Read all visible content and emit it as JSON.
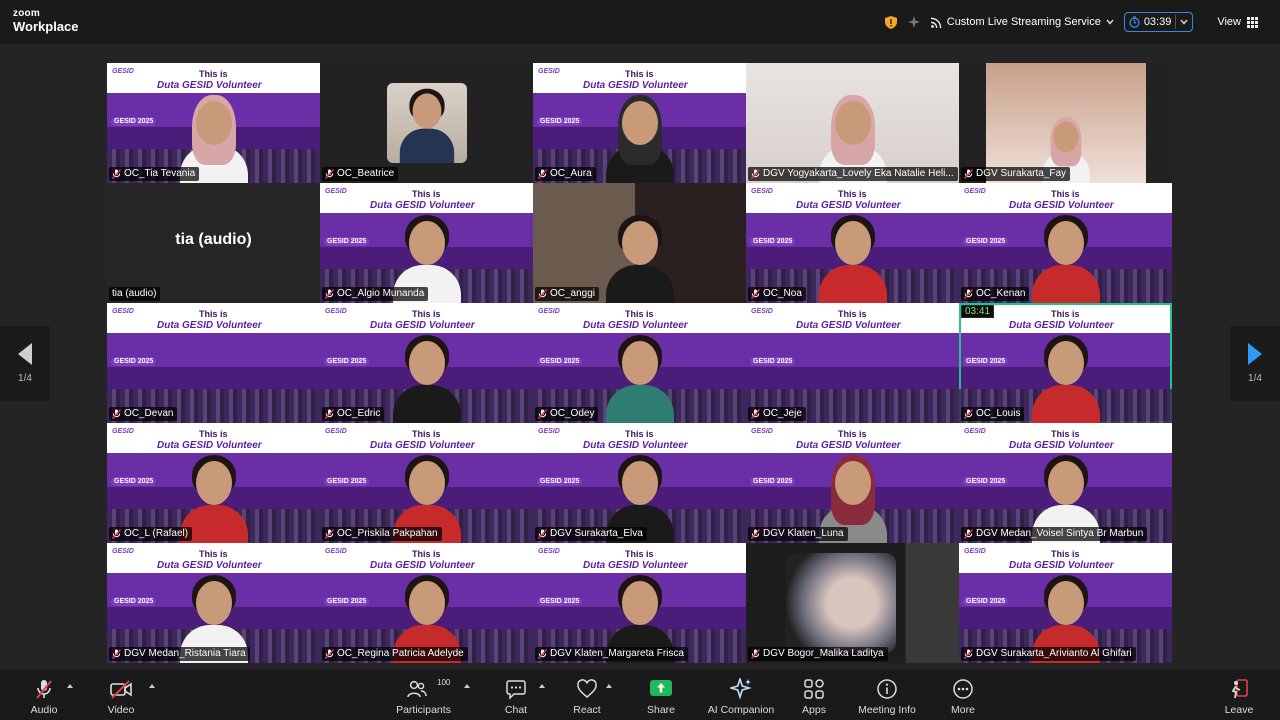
{
  "app": {
    "logo_line1": "zoom",
    "logo_line2": "Workplace"
  },
  "topbar": {
    "streaming_label": "Custom Live Streaming Service",
    "timer": "03:39",
    "view_label": "View"
  },
  "banner": {
    "line1": "This is",
    "line2": "Duta GESID Volunteer",
    "tag": "GESID 2025",
    "corner": "GESID"
  },
  "tiles": [
    {
      "name": "OC_Tia Tevania",
      "bg": "banner",
      "person": "hijab pink shirt-white"
    },
    {
      "name": "OC_Beatrice",
      "bg": "dark-photo",
      "person": ""
    },
    {
      "name": "OC_Aura",
      "bg": "banner",
      "person": "hijab dark shirt-black"
    },
    {
      "name": "DGV Yogyakarta_Lovely Eka Natalie Heli...",
      "bg": "room",
      "person": "hijab pink shirt-white"
    },
    {
      "name": "DGV Surakarta_Fay",
      "bg": "pip",
      "person": ""
    },
    {
      "name": "tia (audio)",
      "bg": "audio",
      "audio_label": "tia (audio)"
    },
    {
      "name": "OC_Algio Munanda",
      "bg": "banner",
      "person": "shirt-white"
    },
    {
      "name": "OC_anggi",
      "bg": "mixed",
      "person": "shirt-black"
    },
    {
      "name": "OC_Noa",
      "bg": "banner",
      "person": "shirt-red"
    },
    {
      "name": "OC_Kenan",
      "bg": "banner",
      "person": "shirt-red"
    },
    {
      "name": "OC_Devan",
      "bg": "banner",
      "person": ""
    },
    {
      "name": "OC_Edric",
      "bg": "banner",
      "person": "shirt-black"
    },
    {
      "name": "OC_Odey",
      "bg": "banner",
      "person": "shirt-teal"
    },
    {
      "name": "OC_Jeje",
      "bg": "banner",
      "person": ""
    },
    {
      "name": "OC_Louis",
      "bg": "banner",
      "person": "shirt-red",
      "active": true,
      "talk_time": "03:41"
    },
    {
      "name": "OC_L (Rafael)",
      "bg": "banner",
      "person": "shirt-red"
    },
    {
      "name": "OC_Priskila Pakpahan",
      "bg": "banner",
      "person": "shirt-red"
    },
    {
      "name": "DGV Surakarta_Elva",
      "bg": "banner",
      "person": "shirt-black"
    },
    {
      "name": "DGV Klaten_Luna",
      "bg": "banner",
      "person": "hijab maroon shirt-gray"
    },
    {
      "name": "DGV Medan_Voisel Sintya Br Marbun",
      "bg": "banner",
      "person": "shirt-white"
    },
    {
      "name": "DGV Medan_Ristania Tiara",
      "bg": "banner",
      "person": "shirt-white"
    },
    {
      "name": "OC_Regina Patricia Adelyde",
      "bg": "banner",
      "person": "shirt-red"
    },
    {
      "name": "DGV Klaten_Margareta Frisca",
      "bg": "banner",
      "person": "shirt-black"
    },
    {
      "name": "DGV Bogor_Malika Laditya",
      "bg": "dark",
      "person": ""
    },
    {
      "name": "DGV Surakarta_Arivianto Al Ghifari",
      "bg": "banner",
      "person": "shirt-red"
    }
  ],
  "pager": {
    "left_label": "1/4",
    "right_label": "1/4"
  },
  "toolbar": {
    "audio": "Audio",
    "video": "Video",
    "participants": "Participants",
    "participants_count": "100",
    "chat": "Chat",
    "react": "React",
    "share": "Share",
    "ai": "AI Companion",
    "apps": "Apps",
    "meeting_info": "Meeting Info",
    "more": "More",
    "leave": "Leave"
  },
  "colors": {
    "accent_blue": "#2e8ce6",
    "active_speaker": "#22c48b",
    "share_green": "#1fb85a",
    "muted_red": "#e0414a",
    "banner_purple": "#6a2fa6"
  }
}
